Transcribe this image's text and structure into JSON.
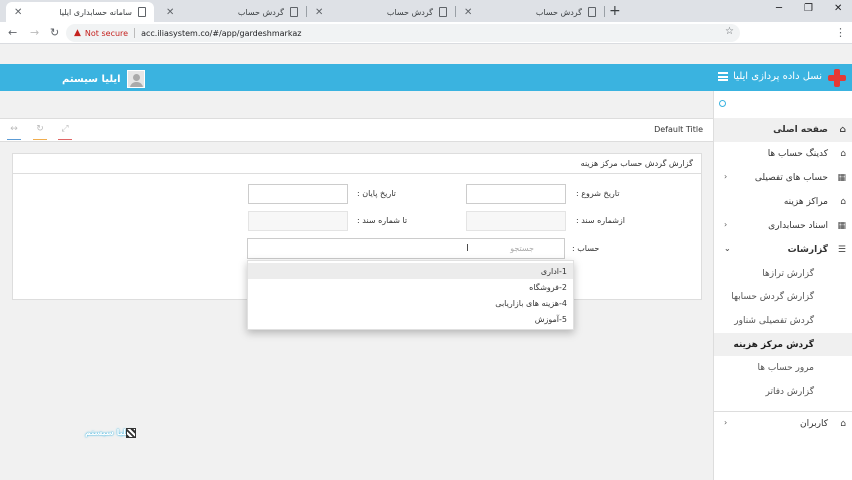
{
  "browser": {
    "tabs": [
      {
        "title": "سامانه حسابداری ایلیا",
        "active": true
      },
      {
        "title": "گردش حساب",
        "active": false
      },
      {
        "title": "گردش حساب",
        "active": false
      },
      {
        "title": "گردش حساب",
        "active": false
      }
    ],
    "security_label": "Not secure",
    "url": "acc.iliasystem.co/#/app/gardeshmarkaz"
  },
  "header": {
    "brand": "نسل داده پردازی ایلیا",
    "username": "ایلیا سیستم",
    "accent_color": "#3ab3e0"
  },
  "page": {
    "title": "Default Title",
    "toolbar_icons": [
      "expand-icon",
      "refresh-icon",
      "fullscreen-icon"
    ]
  },
  "report": {
    "heading": "گزارش گردش حساب مرکز هزینه",
    "labels": {
      "start_date": "تاریخ شروع :",
      "end_date": "تاریخ پایان :",
      "from_doc": "ازشماره سند :",
      "to_doc": "تا شماره سند :",
      "account": "حساب :"
    },
    "account_placeholder": "جستجو",
    "options": [
      "1-اداری",
      "2-فروشگاه",
      "4-هزینه های بازاریابی",
      "5-آموزش"
    ]
  },
  "sidebar": {
    "items": [
      {
        "label": "صفحه اصلی",
        "icon": "home-icon"
      },
      {
        "label": "کدینگ حساب ها",
        "icon": "home-icon"
      },
      {
        "label": "حساب های تفصیلی",
        "icon": "table-icon"
      },
      {
        "label": "مراکز هزینه",
        "icon": "home-icon"
      },
      {
        "label": "اسناد حسابداری",
        "icon": "table-icon"
      },
      {
        "label": "گزارشات",
        "icon": "list-icon"
      }
    ],
    "reports_sub": [
      "گزارش ترازها",
      "گزارش گردش حسابها",
      "گردش تفصیلی شناور",
      "گردش مرکز هزینه",
      "مرور حساب ها",
      "گزارش دفاتر"
    ],
    "users": {
      "label": "کاربران",
      "icon": "home-icon"
    }
  },
  "watermark": "ایلیا سیستم"
}
